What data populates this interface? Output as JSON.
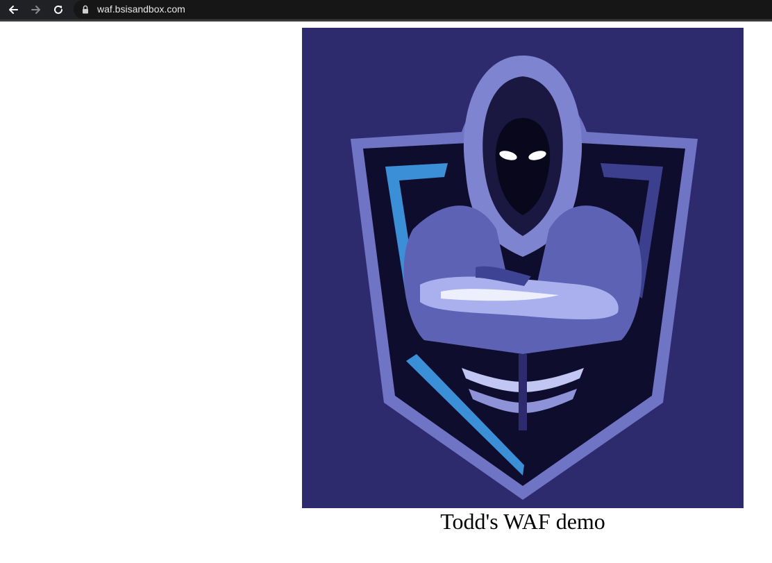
{
  "browser": {
    "url": "waf.bsisandbox.com",
    "back_icon": "back-arrow-icon",
    "forward_icon": "forward-arrow-icon",
    "reload_icon": "reload-icon",
    "lock_icon": "lock-icon"
  },
  "page": {
    "image": {
      "subject": "hooded-figure-shield-logo",
      "colors": {
        "background": "#2e2a6e",
        "shield_outer": "#6f74c4",
        "shield_dark": "#0f0d2e",
        "accent_blue": "#3b8fd6",
        "hood": "#7e84d0"
      }
    },
    "caption": "Todd's WAF demo"
  }
}
